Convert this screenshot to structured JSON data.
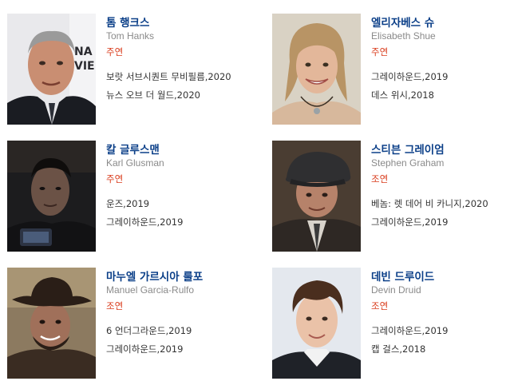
{
  "actors": [
    {
      "name_ko": "톰 행크스",
      "name_en": "Tom Hanks",
      "role": "주연",
      "works": [
        "보랏 서브시퀀트 무비필름,2020",
        "뉴스 오브 더 월드,2020"
      ],
      "photo_icon": "actor-portrait"
    },
    {
      "name_ko": "엘리자베스 슈",
      "name_en": "Elisabeth Shue",
      "role": "주연",
      "works": [
        "그레이하운드,2019",
        "데스 위시,2018"
      ],
      "photo_icon": "actor-portrait"
    },
    {
      "name_ko": "칼 글루스맨",
      "name_en": "Karl Glusman",
      "role": "주연",
      "works": [
        "운즈,2019",
        "그레이하운드,2019"
      ],
      "photo_icon": "actor-portrait"
    },
    {
      "name_ko": "스티븐 그레이엄",
      "name_en": "Stephen Graham",
      "role": "조연",
      "works": [
        "베놈: 렛 데어 비 카니지,2020",
        "그레이하운드,2019"
      ],
      "photo_icon": "actor-portrait"
    },
    {
      "name_ko": "마누엘 가르시아 룰포",
      "name_en": "Manuel Garcia-Rulfo",
      "role": "조연",
      "works": [
        "6 언더그라운드,2019",
        "그레이하운드,2019"
      ],
      "photo_icon": "actor-portrait"
    },
    {
      "name_ko": "데빈 드루이드",
      "name_en": "Devin Druid",
      "role": "조연",
      "works": [
        "그레이하운드,2019",
        "캡 걸스,2018"
      ],
      "photo_icon": "actor-portrait"
    }
  ],
  "colors": {
    "name_link": "#0b3f88",
    "english_name": "#8a8a8a",
    "role": "#d93a1a",
    "work_text": "#333333"
  }
}
